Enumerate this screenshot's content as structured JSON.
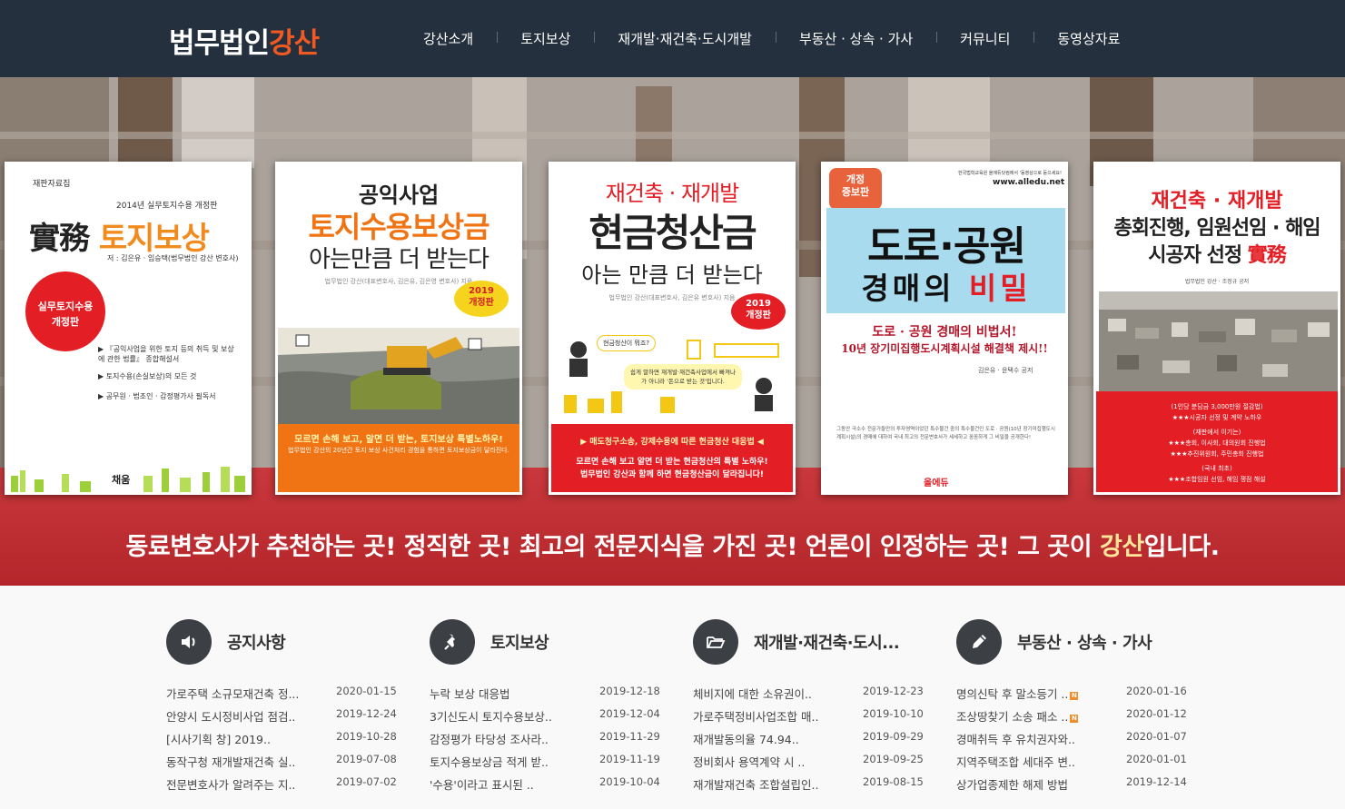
{
  "header": {
    "logo_main": "법무법인",
    "logo_accent": "강산",
    "nav": [
      {
        "label": "강산소개"
      },
      {
        "label": "토지보상"
      },
      {
        "label": "재개발·재건축·도시개발"
      },
      {
        "label": "부동산 · 상속 · 가사"
      },
      {
        "label": "커뮤니티"
      },
      {
        "label": "동영상자료"
      }
    ]
  },
  "hero": {
    "slogan_main": "동료변호사가 추천하는 곳! 정직한 곳! 최고의 전문지식을 가진 곳! 언론이 인정하는 곳! 그 곳이 ",
    "slogan_highlight": "강산",
    "slogan_end": "입니다.",
    "books": {
      "b1": {
        "series": "재판자료집",
        "edition": "2014년 실무토지수용 개정판",
        "title_a": "實務",
        "title_b": "토지보상",
        "author": "저 : 김은유 · 임승택(법무법인 강산 변호사)",
        "circle_a": "실무토지수용",
        "circle_b": "개정판",
        "bullet1": "▶ 『공익사업을 위한 토지 등의 취득 및 보상에 관한 법률』 종합해설서",
        "bullet2": "▶ 토지수용(손실보상)의 모든 것",
        "bullet3": "▶ 공무원 · 법조인 · 감정평가사 필독서",
        "publisher": "채움"
      },
      "b2": {
        "t1": "공익사업",
        "t2": "토지수용보상금",
        "t3": "아는만큼 더 받는다",
        "author": "법무법인 강산(대표변호사, 김은유, 김은영 변호사) 지음",
        "badge_a": "2019",
        "badge_b": "개정판",
        "strip1": "모르면 손해 보고, 알면 더 받는, 토지보상 특별노하우!",
        "strip2": "법무법인 강산의 20년간 토지 보상 사건처리 경험을 통하면 토지보상금이 달라진다."
      },
      "b3": {
        "t1": "재건축 · 재개발",
        "t2": "현금청산금",
        "t3": "아는 만큼 더 받는다",
        "author": "법무법인 강산(대표변호사, 김은유 변호사) 지음",
        "badge_a": "2019",
        "badge_b": "개정판",
        "bubble1": "현금청산이 뭐죠?",
        "bubble2": "쉽게 말하면 재개발·재건축사업에서 빠져나가 아니라 '돈으로 받는 것'입니다.",
        "strip0": "▶ 매도청구소송, 강제수용에 따른 현금청산 대응법 ◀",
        "strip1": "모르면 손해 보고 알면 더 받는 현금청산의 특별 노하우!",
        "strip2": "법무법인 강산과 함께 하면 현금청산금이 달라집니다!"
      },
      "b4": {
        "tag_a": "개정",
        "tag_b": "증보판",
        "small": "한국법학교육원 올에듀닷컴에서 '동영상으로 듣으세요!",
        "url": "www.alledu.net",
        "t1": "도로·공원",
        "t2_a": "경매의 ",
        "t2_b": "비밀",
        "s1": "도로 · 공원 경매의 비법서!",
        "s2": "10년 장기미집행도시계획시설 해결책 제시!!",
        "author": "김은유 · 윤택수 공저",
        "desc": "그동안 극소수 전문가들만의 투자영역이었던 특수물건 중의 특수물건인 도로 · 공원(10년 장기미집행도시계획시설)의 경매에 대하여 국내 최고의 전문변호사가 세세하고 꼼꼼하게 그 비밀을 공개한다!",
        "publisher": "올에듀"
      },
      "b5": {
        "t1": "재건축 · 재개발",
        "t2": "총회진행, 임원선임 · 해임",
        "t3_a": "시공자 선정 ",
        "t3_b": "實務",
        "author": "법무법인 강산 · 조정규 공저",
        "l1": "(1인당 분담금 3,000만원 절감법)",
        "l2": "★★★시공자 선정 및 계약 노하우",
        "l3": "(재판에서 이기는)",
        "l4": "★★★총회, 이사회, 대의원회 진행법",
        "l5": "★★★추진위원회, 주민총회 진행법",
        "l6": "(국내 최초)",
        "l7": "★★★조합임원 선임, 해임 쟁점 해설"
      }
    }
  },
  "sections": [
    {
      "title": "공지사항",
      "icon": "speaker-icon",
      "rows": [
        {
          "title": "가로주택 소규모재건축 정...",
          "date": "2020-01-15",
          "new": false
        },
        {
          "title": "안양시 도시정비사업 점검..",
          "date": "2019-12-24",
          "new": false
        },
        {
          "title": "[시사기획 창] 2019..",
          "date": "2019-10-28",
          "new": false
        },
        {
          "title": "동작구청 재개발재건축 실..",
          "date": "2019-07-08",
          "new": false
        },
        {
          "title": "전문변호사가 알려주는 지..",
          "date": "2019-07-02",
          "new": false
        }
      ]
    },
    {
      "title": "토지보상",
      "icon": "pin-icon",
      "rows": [
        {
          "title": "누락 보상 대응법",
          "date": "2019-12-18",
          "new": false
        },
        {
          "title": "3기신도시 토지수용보상..",
          "date": "2019-12-04",
          "new": false
        },
        {
          "title": "감정평가 타당성 조사라..",
          "date": "2019-11-29",
          "new": false
        },
        {
          "title": "토지수용보상금 적게 받..",
          "date": "2019-11-19",
          "new": false
        },
        {
          "title": "'수용'이라고 표시된 ..",
          "date": "2019-10-04",
          "new": false
        }
      ]
    },
    {
      "title": "재개발·재건축·도시...",
      "icon": "folder-icon",
      "rows": [
        {
          "title": "체비지에 대한 소유권이..",
          "date": "2019-12-23",
          "new": false
        },
        {
          "title": "가로주택정비사업조합 매..",
          "date": "2019-10-10",
          "new": false
        },
        {
          "title": "재개발동의율 74.94..",
          "date": "2019-09-29",
          "new": false
        },
        {
          "title": "정비회사 용역계약 시 ..",
          "date": "2019-09-25",
          "new": false
        },
        {
          "title": "재개발재건축 조합설립인..",
          "date": "2019-08-15",
          "new": false
        }
      ]
    },
    {
      "title": "부동산 · 상속 · 가사",
      "icon": "pencil-icon",
      "rows": [
        {
          "title": "명의신탁 후 말소등기 ..",
          "date": "2020-01-16",
          "new": true
        },
        {
          "title": "조상땅찾기 소송 패소 ..",
          "date": "2020-01-12",
          "new": true
        },
        {
          "title": "경매취득 후 유치권자와..",
          "date": "2020-01-07",
          "new": false
        },
        {
          "title": "지역주택조합 세대주 변..",
          "date": "2020-01-01",
          "new": false
        },
        {
          "title": "상가업종제한 해제 방법",
          "date": "2019-12-14",
          "new": false
        }
      ]
    }
  ],
  "new_badge": "N"
}
